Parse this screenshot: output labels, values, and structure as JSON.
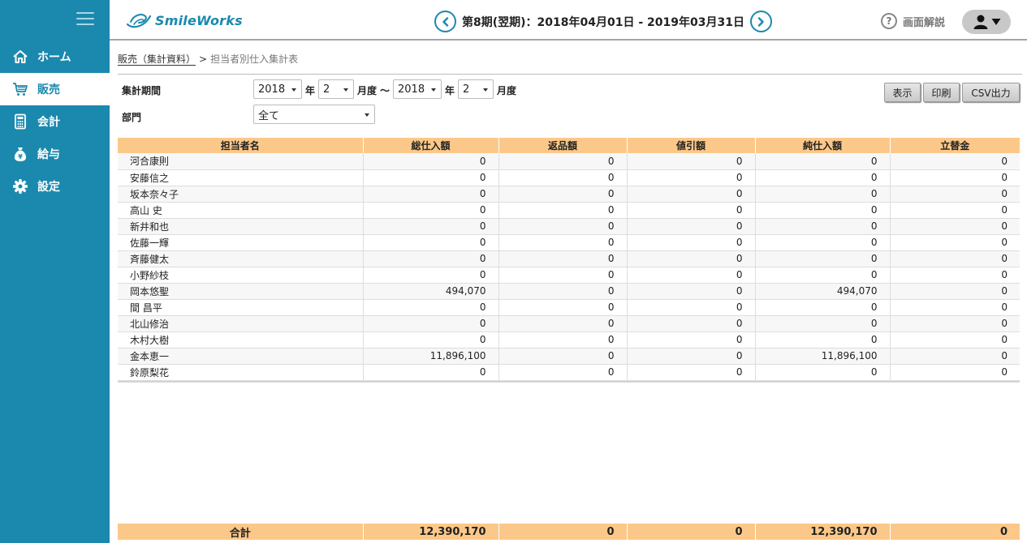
{
  "sidebar": {
    "items": [
      {
        "label": "ホーム",
        "icon": "home-icon"
      },
      {
        "label": "販売",
        "icon": "cart-icon",
        "active": true
      },
      {
        "label": "会計",
        "icon": "calculator-icon"
      },
      {
        "label": "給与",
        "icon": "money-bag-icon"
      },
      {
        "label": "設定",
        "icon": "gear-icon"
      }
    ]
  },
  "header": {
    "logo_text": "SmileWorks",
    "period": "第8期(翌期)：2018年04月01日 - 2019年03月31日",
    "help_label": "画面解説"
  },
  "breadcrumb": {
    "parent": "販売（集計資料）",
    "separator": ">",
    "current": "担当者別仕入集計表"
  },
  "filters": {
    "period_label": "集計期間",
    "from_year": "2018",
    "from_month": "2",
    "to_year": "2018",
    "to_month": "2",
    "year_unit": "年",
    "month_unit": "月度",
    "range_sep": "〜",
    "dept_label": "部門",
    "dept_value": "全て"
  },
  "actions": {
    "show": "表示",
    "print": "印刷",
    "csv": "CSV出力"
  },
  "table": {
    "columns": [
      "担当者名",
      "総仕入額",
      "返品額",
      "値引額",
      "純仕入額",
      "立替金"
    ],
    "rows": [
      [
        "河合康則",
        "0",
        "0",
        "0",
        "0",
        "0"
      ],
      [
        "安藤信之",
        "0",
        "0",
        "0",
        "0",
        "0"
      ],
      [
        "坂本奈々子",
        "0",
        "0",
        "0",
        "0",
        "0"
      ],
      [
        "高山 史",
        "0",
        "0",
        "0",
        "0",
        "0"
      ],
      [
        "新井和也",
        "0",
        "0",
        "0",
        "0",
        "0"
      ],
      [
        "佐藤一輝",
        "0",
        "0",
        "0",
        "0",
        "0"
      ],
      [
        "斉藤健太",
        "0",
        "0",
        "0",
        "0",
        "0"
      ],
      [
        "小野紗枝",
        "0",
        "0",
        "0",
        "0",
        "0"
      ],
      [
        "岡本悠聖",
        "494,070",
        "0",
        "0",
        "494,070",
        "0"
      ],
      [
        "間 昌平",
        "0",
        "0",
        "0",
        "0",
        "0"
      ],
      [
        "北山修治",
        "0",
        "0",
        "0",
        "0",
        "0"
      ],
      [
        "木村大樹",
        "0",
        "0",
        "0",
        "0",
        "0"
      ],
      [
        "金本恵一",
        "11,896,100",
        "0",
        "0",
        "11,896,100",
        "0"
      ],
      [
        "鈴原梨花",
        "0",
        "0",
        "0",
        "0",
        "0"
      ]
    ],
    "totals": [
      "合計",
      "12,390,170",
      "0",
      "0",
      "12,390,170",
      "0"
    ]
  },
  "colors": {
    "sidebar": "#1b89ae",
    "table_header": "#fcc889"
  }
}
